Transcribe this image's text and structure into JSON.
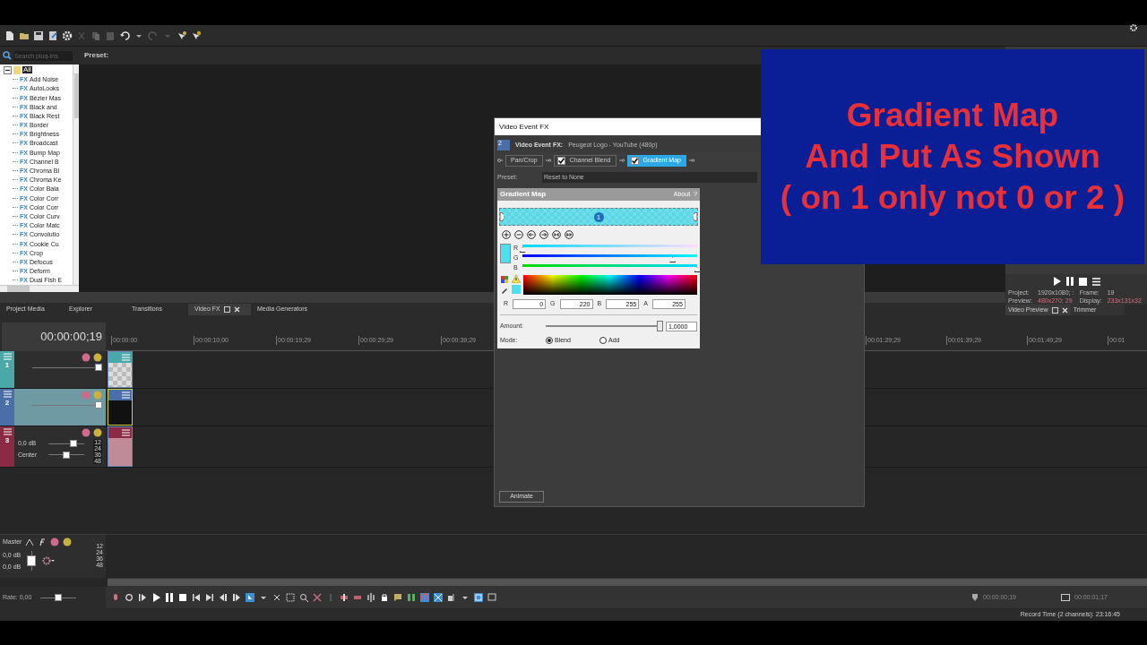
{
  "plugin_browser": {
    "search": {
      "placeholder": "Search plug-ins"
    },
    "preset_label": "Preset:",
    "tree": {
      "label": "All",
      "expanded": true,
      "selected": true,
      "children": [
        {
          "badge": "FX",
          "label": "Add Noise",
          "selected": false
        },
        {
          "badge": "FX",
          "label": "AutoLooks",
          "selected": false
        },
        {
          "badge": "FX",
          "label": "Bézier Mas",
          "selected": false
        },
        {
          "badge": "FX",
          "label": "Black and",
          "selected": false
        },
        {
          "badge": "FX",
          "label": "Black Rest",
          "selected": false
        },
        {
          "badge": "FX",
          "label": "Border",
          "selected": false
        },
        {
          "badge": "FX",
          "label": "Brightness",
          "selected": false
        },
        {
          "badge": "FX",
          "label": "Broadcast",
          "selected": false
        },
        {
          "badge": "FX",
          "label": "Bump Map",
          "selected": false
        },
        {
          "badge": "FX",
          "label": "Channel B",
          "selected": false
        },
        {
          "badge": "FX",
          "label": "Chroma Bl",
          "selected": false
        },
        {
          "badge": "FX",
          "label": "Chroma Ke",
          "selected": false
        },
        {
          "badge": "FX",
          "label": "Color Bala",
          "selected": false
        },
        {
          "badge": "FX",
          "label": "Color Corr",
          "selected": false
        },
        {
          "badge": "FX",
          "label": "Color Corr",
          "selected": false
        },
        {
          "badge": "FX",
          "label": "Color Curv",
          "selected": false
        },
        {
          "badge": "FX",
          "label": "Color Matc",
          "selected": false
        },
        {
          "badge": "FX",
          "label": "Convolutio",
          "selected": false
        },
        {
          "badge": "FX",
          "label": "Cookie Cu",
          "selected": false
        },
        {
          "badge": "FX",
          "label": "Crop",
          "selected": false
        },
        {
          "badge": "FX",
          "label": "Defocus",
          "selected": false
        },
        {
          "badge": "FX",
          "label": "Deform",
          "selected": false
        },
        {
          "badge": "FX",
          "label": "Dual Fish E",
          "selected": false
        }
      ]
    }
  },
  "dock_tabs": [
    {
      "label": "Project Media",
      "selected": false
    },
    {
      "label": "Explorer",
      "selected": false
    },
    {
      "label": "Transitions",
      "selected": false
    },
    {
      "label": "Video FX",
      "selected": true
    },
    {
      "label": "Media Generators",
      "selected": false
    }
  ],
  "video_preview": {
    "project_label": "Project:",
    "project_value": "1920x1080; :",
    "frame_label": "Frame:",
    "frame_value": "19",
    "preview_label": "Preview:",
    "preview_value": "480x270; 29",
    "display_label": "Display:",
    "display_value": "233x131x32",
    "tabs": [
      {
        "label": "Video Preview",
        "selected": true
      },
      {
        "label": "Trimmer",
        "selected": false
      }
    ]
  },
  "timeline": {
    "timecode": "00:00:00;19",
    "ruler_left": [
      "00:00:00",
      "00:00:10;00",
      "00:00:19;29",
      "00:00:29;29",
      "00:00:39;29"
    ],
    "ruler_right": [
      "00:01:29;29",
      "00:01:39;29",
      "00:01:49;29",
      "00:01"
    ],
    "tracks": [
      {
        "number": "1",
        "kind": "video",
        "color": "#4aa8a8",
        "selected": false,
        "level": 1
      },
      {
        "number": "2",
        "kind": "video",
        "color": "#4a6fa8",
        "selected": true,
        "level": 1
      },
      {
        "number": "3",
        "kind": "audio",
        "color": "#8a2a45",
        "selected": false,
        "volume": {
          "value": "0,0 dB",
          "level": 0.75
        },
        "pan": {
          "value": "Center",
          "level": 0.5
        },
        "meter": [
          "12",
          "24",
          "36",
          "48"
        ]
      }
    ]
  },
  "master": {
    "label": "Master",
    "volume_left": "0,0 dB",
    "volume_right": "0,0 dB",
    "fader": {
      "level": 0.5
    },
    "meter": [
      "12",
      "24",
      "36",
      "48"
    ],
    "rate": {
      "value": "Rate: 0,00",
      "level": 0.5
    }
  },
  "transport": {
    "cursor_time": "00:00:00;19",
    "length_time": "00:00:01;17"
  },
  "status_bar": "Record Time (2 channels): 23:16:45",
  "dialog": {
    "title": "Video Event FX",
    "header_label": "Video Event FX:",
    "header_value": "Peugeot Logo - YouTube (480p)",
    "track_badge": "2",
    "chain": [
      {
        "label": "Pan/Crop",
        "kind": "plain",
        "selected": false
      },
      {
        "label": "Channel Blend",
        "kind": "check",
        "checked": true,
        "selected": false
      },
      {
        "label": "Gradient Map",
        "kind": "check",
        "checked": true,
        "selected": true
      }
    ],
    "preset_label": "Preset:",
    "preset_value": "Reset to None",
    "plugin": {
      "title": "Gradient Map",
      "about": "About",
      "help": "?",
      "stop": {
        "label": "1",
        "selected": true
      },
      "channels": [
        {
          "label": "R",
          "level": 0
        },
        {
          "label": "G",
          "level": 0.86
        },
        {
          "label": "B",
          "level": 1
        }
      ],
      "fields": [
        {
          "label": "R",
          "value": "0"
        },
        {
          "label": "G",
          "value": "220"
        },
        {
          "label": "B",
          "value": "255"
        },
        {
          "label": "A",
          "value": "255"
        }
      ],
      "amount_label": "Amount:",
      "amount": {
        "level": 1,
        "value": "1,0000"
      },
      "mode_label": "Mode:",
      "modes": [
        {
          "label": "Blend",
          "selected": true
        },
        {
          "label": "Add",
          "selected": false
        }
      ]
    },
    "animate_button": "Animate"
  },
  "annotation": [
    "Gradient Map",
    "And Put As Shown",
    "( on 1 only not 0 or 2 )"
  ]
}
